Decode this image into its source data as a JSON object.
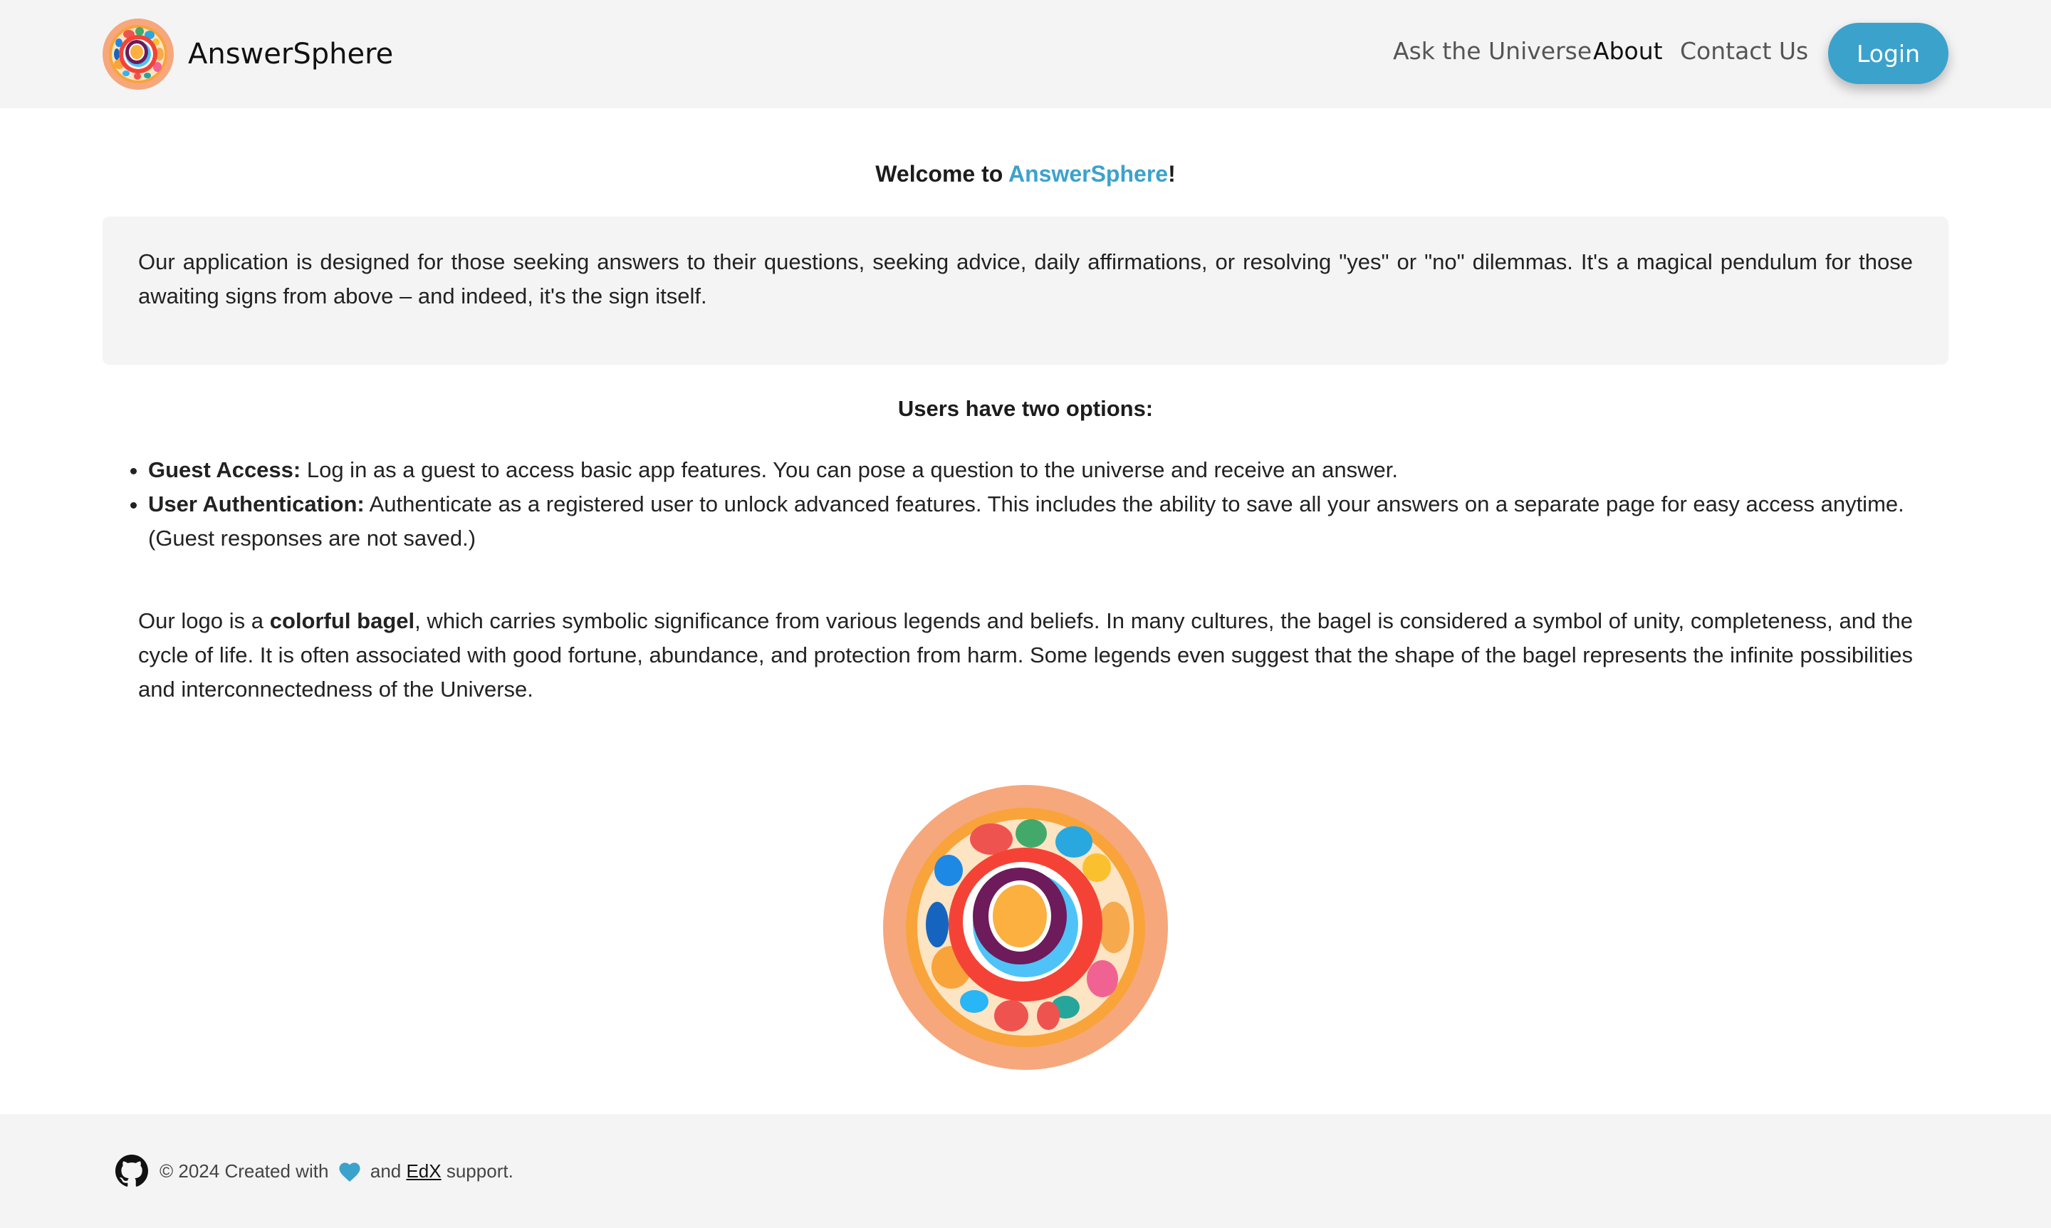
{
  "header": {
    "brand_name": "AnswerSphere",
    "nav": [
      {
        "label": "Ask the Universe",
        "active": false
      },
      {
        "label": "About",
        "active": true
      },
      {
        "label": "Contact Us",
        "active": false
      }
    ],
    "login_label": "Login"
  },
  "main": {
    "welcome_prefix": "Welcome to ",
    "welcome_brand": "AnswerSphere",
    "welcome_suffix": "!",
    "intro": "Our application is designed for those seeking answers to their questions, seeking advice, daily affirmations, or resolving \"yes\" or \"no\" dilemmas. It's a magical pendulum for those awaiting signs from above – and indeed, it's the sign itself.",
    "options_title": "Users have two options:",
    "options": [
      {
        "title": "Guest Access:",
        "text": " Log in as a guest to access basic app features. You can pose a question to the universe and receive an answer."
      },
      {
        "title": "User Authentication:",
        "text": " Authenticate as a registered user to unlock advanced features. This includes the ability to save all your answers on a separate page for easy access anytime. (Guest responses are not saved.)"
      }
    ],
    "logo_text_prefix": "Our logo is a ",
    "logo_text_bold": "colorful bagel",
    "logo_text_rest": ", which carries symbolic significance from various legends and beliefs. In many cultures, the bagel is considered a symbol of unity, completeness, and the cycle of life. It is often associated with good fortune, abundance, and protection from harm. Some legends even suggest that the shape of the bagel represents the infinite possibilities and interconnectedness of the Universe."
  },
  "footer": {
    "copyright": "© 2024 Created with ",
    "and": " and ",
    "edx": "EdX",
    "support": " support."
  },
  "colors": {
    "accent": "#3ba2cc",
    "header_bg": "#f4f4f4"
  },
  "icons": [
    "bagel-logo-icon",
    "github-icon",
    "heart-icon"
  ]
}
